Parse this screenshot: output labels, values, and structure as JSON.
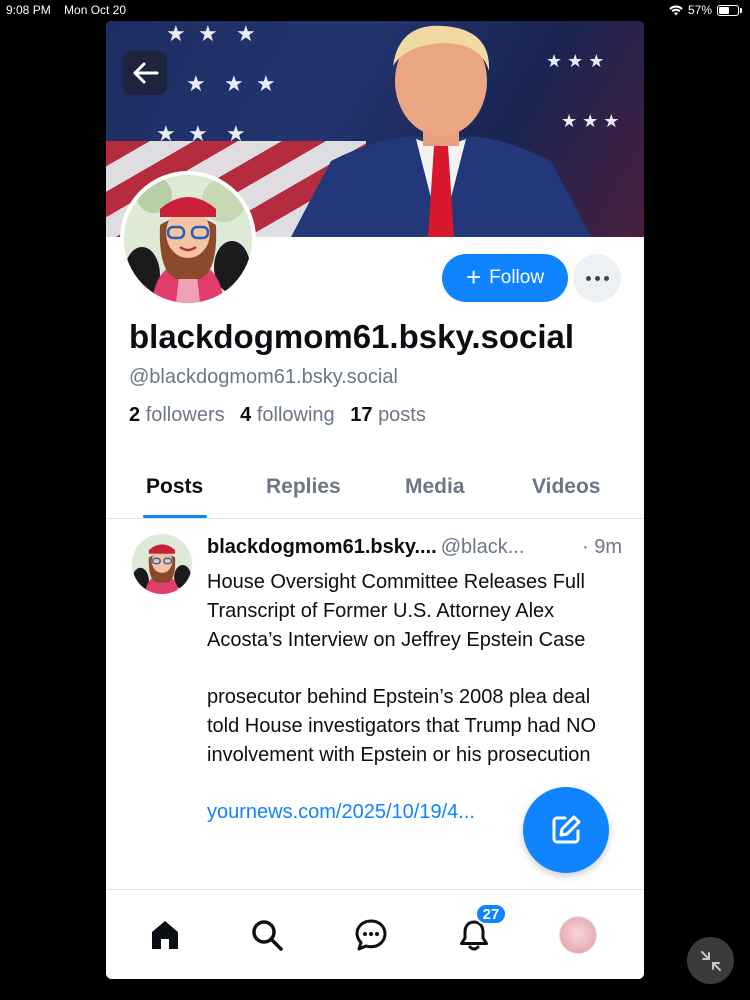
{
  "status_bar": {
    "time": "9:08 PM",
    "date": "Mon Oct 20",
    "battery": "57%"
  },
  "profile": {
    "display_name": "blackdogmom61.bsky.social",
    "handle": "@blackdogmom61.bsky.social",
    "followers_count": "2",
    "followers_label": "followers",
    "following_count": "4",
    "following_label": "following",
    "posts_count": "17",
    "posts_label": "posts",
    "follow_label": "Follow"
  },
  "tabs": [
    {
      "label": "Posts",
      "active": true
    },
    {
      "label": "Replies",
      "active": false
    },
    {
      "label": "Media",
      "active": false
    },
    {
      "label": "Videos",
      "active": false
    }
  ],
  "post": {
    "author": "blackdogmom61.bsky....",
    "handle": "@black...",
    "time": "· 9m",
    "paragraph1": "House Oversight Committee Releases Full Transcript of Former U.S. Attorney Alex Acosta’s Interview on Jeffrey Epstein Case",
    "paragraph2": "prosecutor behind Epstein’s 2008 plea deal told House investigators that Trump had NO involvement with Epstein or his prosecution",
    "link": "yournews.com/2025/10/19/4..."
  },
  "bottom_nav": {
    "items": [
      "home-icon",
      "search-icon",
      "chat-icon",
      "bell-icon",
      "profile-avatar"
    ],
    "notifications_badge": "27"
  },
  "colors": {
    "accent": "#1083fe",
    "text": "#0b0f14",
    "muted": "#6b7785"
  }
}
